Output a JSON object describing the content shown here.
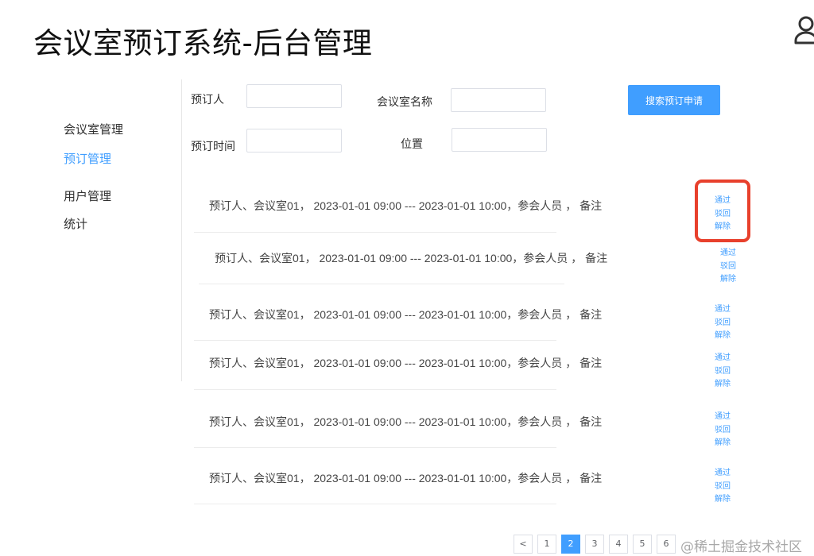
{
  "header": {
    "title": "会议室预订系统-后台管理",
    "user_icon": "user-icon"
  },
  "sidebar": {
    "items": [
      {
        "label": "会议室管理",
        "active": false
      },
      {
        "label": "预订管理",
        "active": true
      },
      {
        "label": "用户管理",
        "active": false
      },
      {
        "label": "统计",
        "active": false
      }
    ]
  },
  "search": {
    "booker_label": "预订人",
    "booker_value": "",
    "room_name_label": "会议室名称",
    "room_name_value": "",
    "time_label": "预订时间",
    "time_value": "",
    "location_label": "位置",
    "location_value": "",
    "search_button": "搜索预订申请"
  },
  "bookings": [
    {
      "text": "预订人、会议室01， 2023-01-01 09:00 --- 2023-01-01 10:00，参会人员 ， 备注",
      "actions": [
        "通过",
        "驳回",
        "解除"
      ]
    },
    {
      "text": "预订人、会议室01， 2023-01-01 09:00 --- 2023-01-01 10:00，参会人员 ， 备注",
      "actions": [
        "通过",
        "驳回",
        "解除"
      ]
    },
    {
      "text": "预订人、会议室01， 2023-01-01 09:00 --- 2023-01-01 10:00，参会人员 ， 备注",
      "actions": [
        "通过",
        "驳回",
        "解除"
      ]
    },
    {
      "text": "预订人、会议室01， 2023-01-01 09:00 --- 2023-01-01 10:00，参会人员 ， 备注",
      "actions": [
        "通过",
        "驳回",
        "解除"
      ]
    },
    {
      "text": "预订人、会议室01， 2023-01-01 09:00 --- 2023-01-01 10:00，参会人员 ， 备注",
      "actions": [
        "通过",
        "驳回",
        "解除"
      ]
    },
    {
      "text": "预订人、会议室01， 2023-01-01 09:00 --- 2023-01-01 10:00，参会人员 ， 备注",
      "actions": [
        "通过",
        "驳回",
        "解除"
      ]
    }
  ],
  "pagination": {
    "prev": "<",
    "pages": [
      "1",
      "2",
      "3",
      "4",
      "5",
      "6"
    ],
    "current": "2"
  },
  "watermark": "@稀土掘金技术社区",
  "colors": {
    "accent": "#409eff",
    "highlight": "#e8402c"
  }
}
